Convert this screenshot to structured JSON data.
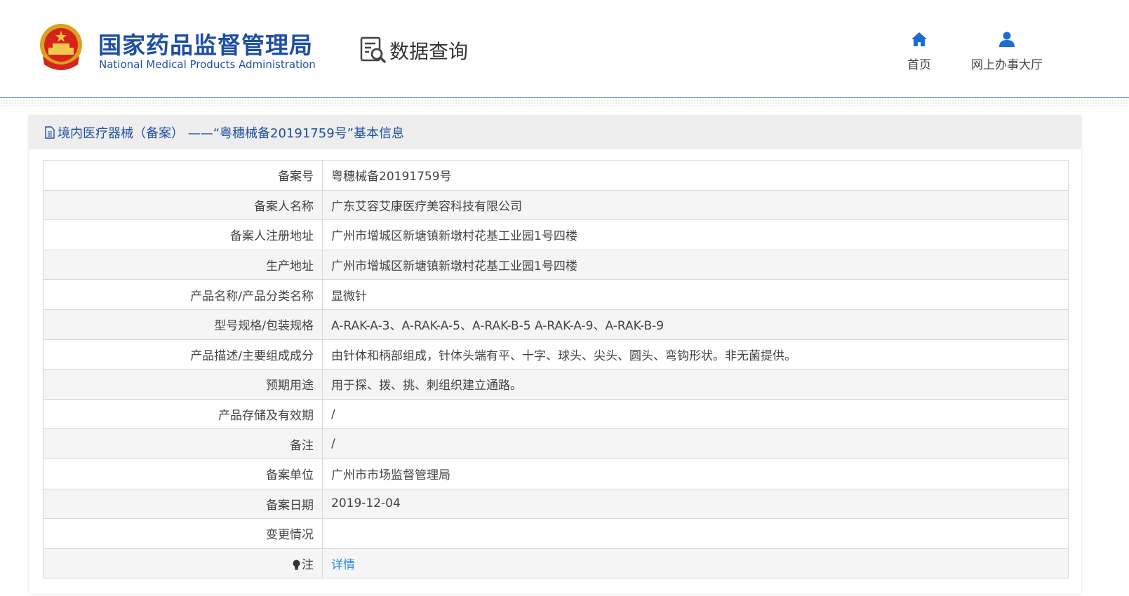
{
  "header": {
    "logo_cn": "国家药品监督管理局",
    "logo_en": "National Medical Products Administration",
    "query_title": "数据查询",
    "nav": {
      "home_label": "首页",
      "hall_label": "网上办事大厅"
    },
    "colors": {
      "brand": "#1e4fa3",
      "link": "#2f8de4"
    }
  },
  "panel": {
    "title": "境内医疗器械（备案） ——“粤穗械备20191759号”基本信息"
  },
  "rows": [
    {
      "label": "备案号",
      "value": "粤穗械备20191759号"
    },
    {
      "label": "备案人名称",
      "value": "广东艾容艾康医疗美容科技有限公司"
    },
    {
      "label": "备案人注册地址",
      "value": "广州市增城区新塘镇新墩村花基工业园1号四楼"
    },
    {
      "label": "生产地址",
      "value": "广州市增城区新塘镇新墩村花基工业园1号四楼"
    },
    {
      "label": "产品名称/产品分类名称",
      "value": "显微针"
    },
    {
      "label": "型号规格/包装规格",
      "value": "A-RAK-A-3、A-RAK-A-5、A-RAK-B-5 A-RAK-A-9、A-RAK-B-9"
    },
    {
      "label": "产品描述/主要组成成分",
      "value": "由针体和柄部组成，针体头端有平、十字、球头、尖头、圆头、弯钩形状。非无菌提供。"
    },
    {
      "label": "预期用途",
      "value": "用于探、拨、挑、刺组织建立通路。"
    },
    {
      "label": "产品存储及有效期",
      "value": "/"
    },
    {
      "label": "备注",
      "value": "/"
    },
    {
      "label": "备案单位",
      "value": "广州市市场监督管理局"
    },
    {
      "label": "备案日期",
      "value": "2019-12-04"
    },
    {
      "label": "变更情况",
      "value": ""
    },
    {
      "label": "注",
      "value": "详情"
    }
  ]
}
